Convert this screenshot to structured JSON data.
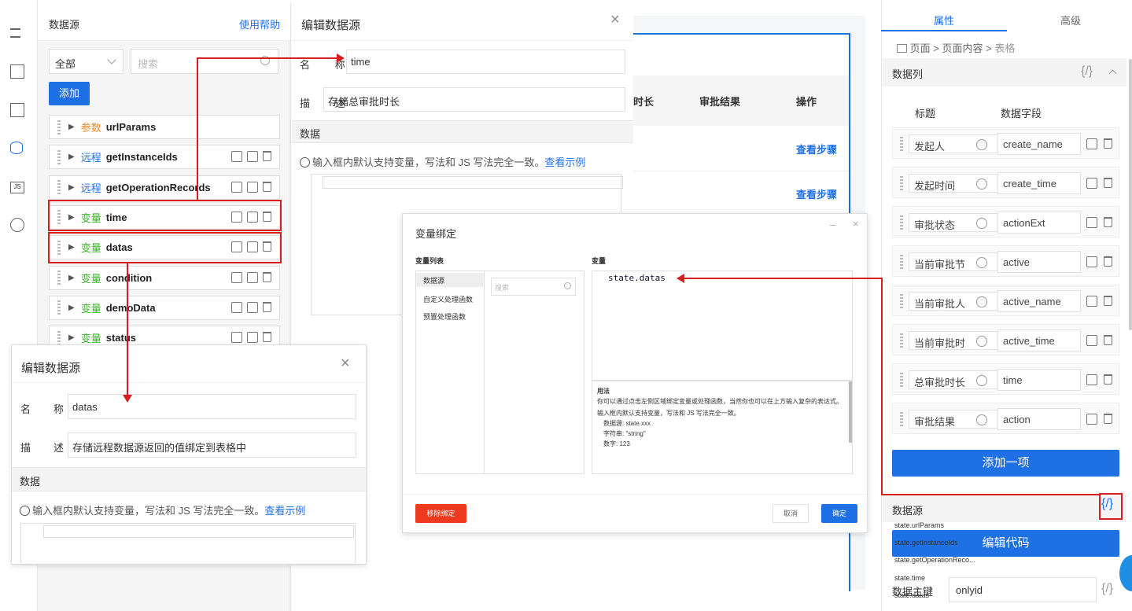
{
  "sidebar_icons": [
    "outline-icon",
    "components-icon",
    "layout-icon",
    "datasource-icon",
    "js-icon",
    "globe-icon"
  ],
  "ds_panel": {
    "title": "数据源",
    "help": "使用帮助",
    "filter": "全部",
    "search_placeholder": "搜索",
    "add": "添加",
    "items": [
      {
        "kind": "参数",
        "name": "urlParams",
        "color": "orange",
        "ops": false
      },
      {
        "kind": "远程",
        "name": "getInstanceIds",
        "color": "blue",
        "ops": true
      },
      {
        "kind": "远程",
        "name": "getOperationRecords",
        "color": "blue",
        "ops": true
      },
      {
        "kind": "变量",
        "name": "time",
        "color": "green",
        "ops": true
      },
      {
        "kind": "变量",
        "name": "datas",
        "color": "green",
        "ops": true
      },
      {
        "kind": "变量",
        "name": "condition",
        "color": "green",
        "ops": true
      },
      {
        "kind": "变量",
        "name": "demoData",
        "color": "green",
        "ops": true
      },
      {
        "kind": "变量",
        "name": "status",
        "color": "green",
        "ops": true
      }
    ]
  },
  "edit1": {
    "title": "编辑数据源",
    "name_label": "名 称",
    "name_value": "time",
    "desc_label": "描 述",
    "desc_value": "存储总审批时长",
    "data_label": "数据",
    "hint": "输入框内默认支持变量，写法和 JS 写法完全一致。",
    "hint_link": "查看示例"
  },
  "edit2": {
    "title": "编辑数据源",
    "name_label_a": "名",
    "name_label_b": "称",
    "name_value": "datas",
    "desc_label_a": "描",
    "desc_label_b": "述",
    "desc_value": "存储远程数据源返回的值绑定到表格中",
    "data_label": "数据",
    "hint": "输入框内默认支持变量，写法和 JS 写法完全一致。",
    "hint_link": "查看示例"
  },
  "table": {
    "headers": [
      "时长",
      "审批结果",
      "操作"
    ],
    "action": "查看步骤"
  },
  "binding": {
    "title": "变量绑定",
    "list_label": "变量列表",
    "var_label": "变量",
    "categories": [
      "数据源",
      "自定义处理函数",
      "预置处理函数"
    ],
    "search_placeholder": "搜索",
    "vars": [
      "state.urlParams",
      "state.getInstanceIds",
      "state.getOperationReco...",
      "state.time",
      "state.datas"
    ],
    "expr": "state.datas",
    "usage_title": "用法",
    "usage_text": "你可以通过点击左侧区域绑定变量或处理函数，当然你也可以在上方输入复杂的表达式。",
    "usage_text2": "输入框内默认支持变量，写法和 JS 写法完全一致。",
    "usage_ex1": "数据源: state.xxx",
    "usage_ex2": "字符串: \"string\"",
    "usage_ex3": "数字: 123",
    "remove": "移除绑定",
    "cancel": "取消",
    "ok": "确定"
  },
  "props": {
    "tab_props": "属性",
    "tab_adv": "高级",
    "crumb": [
      "页面",
      "页面内容",
      "表格"
    ],
    "columns_title": "数据列",
    "code_icon": "{/}",
    "col_title": "标题",
    "col_field": "数据字段",
    "rows": [
      [
        "发起人",
        "create_name"
      ],
      [
        "发起时间",
        "create_time"
      ],
      [
        "审批状态",
        "actionExt"
      ],
      [
        "当前审批节",
        "active"
      ],
      [
        "当前审批人",
        "active_name"
      ],
      [
        "当前审批时",
        "active_time"
      ],
      [
        "总审批时长",
        "time"
      ],
      [
        "审批结果",
        "action"
      ]
    ],
    "add_item": "添加一项",
    "ds_title": "数据源",
    "edit_code": "编辑代码",
    "pk_label": "数据主键",
    "pk_value": "onlyid"
  },
  "colors": {
    "accent": "#1f6fe5",
    "red": "#d81e1e",
    "green": "#3eaf2c",
    "orange": "#f08a24"
  }
}
